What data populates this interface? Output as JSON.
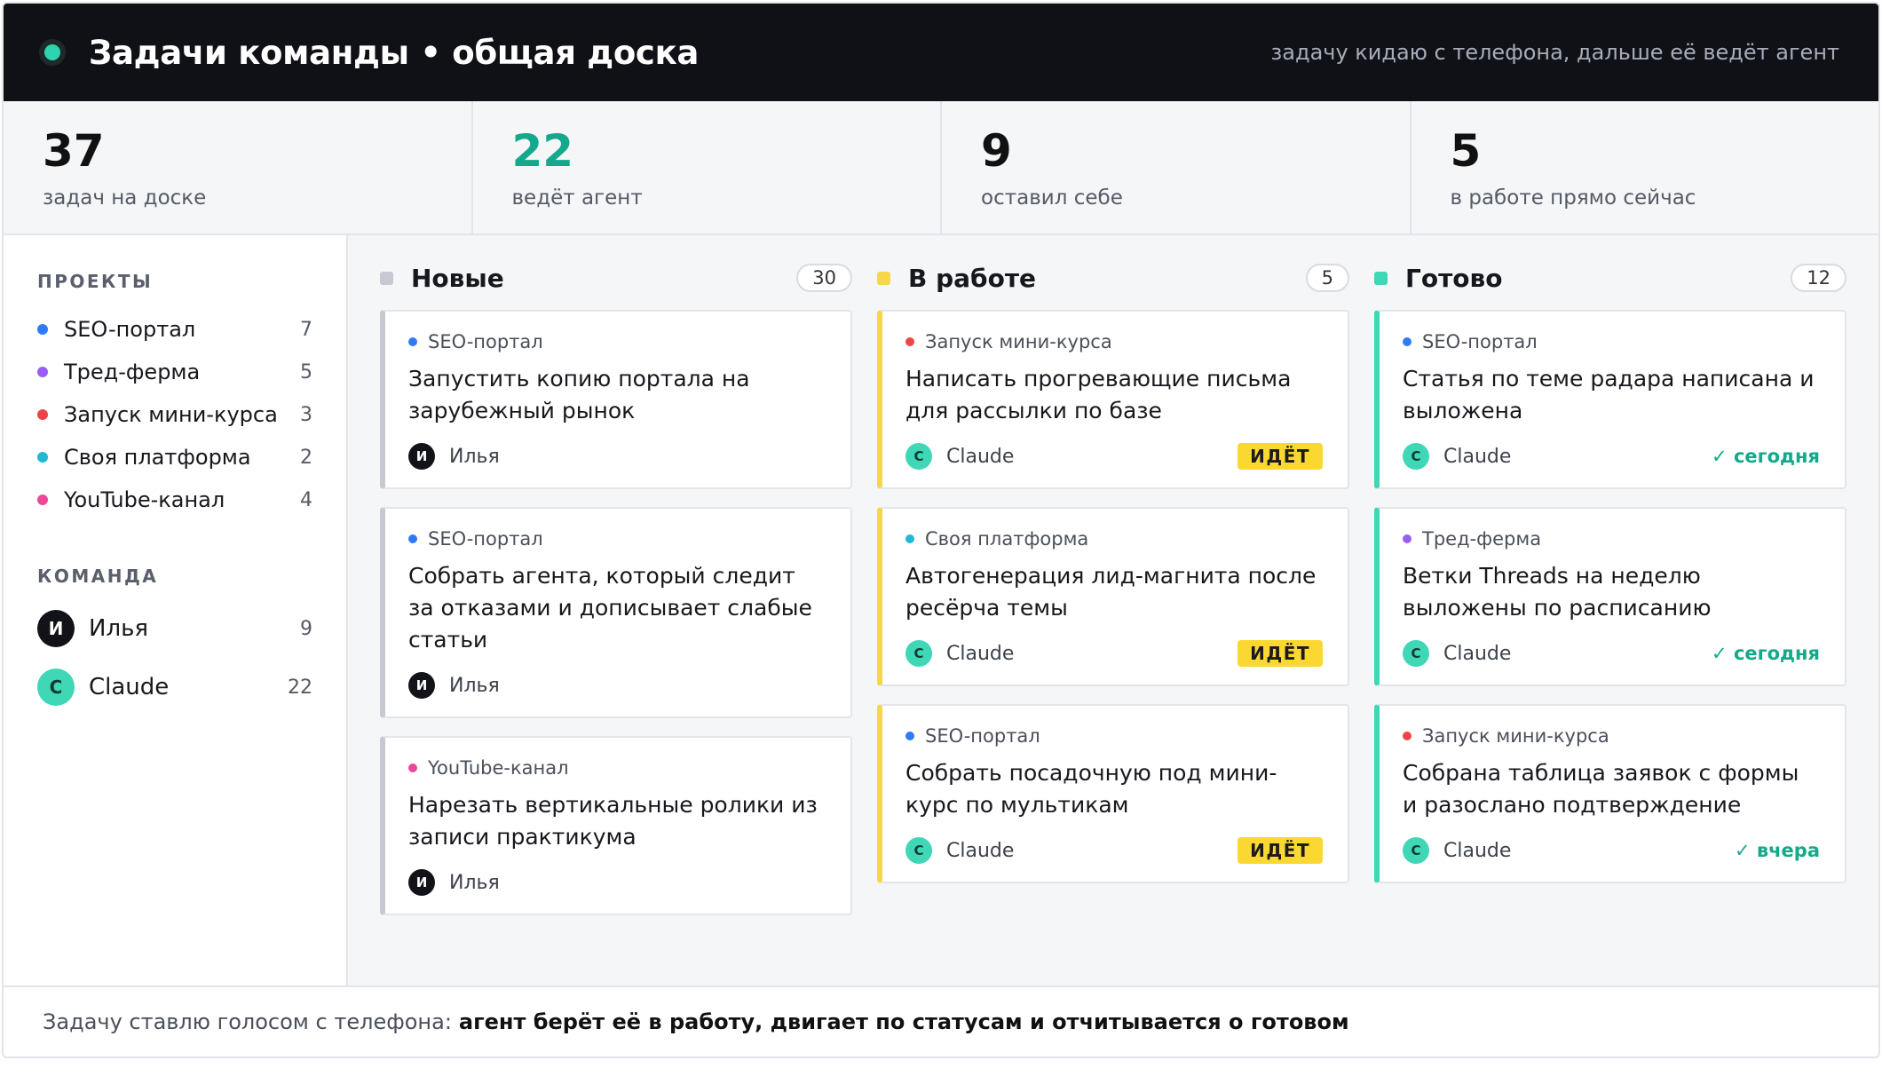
{
  "header": {
    "title": "Задачи команды • общая доска",
    "subtitle": "задачу кидаю с телефона, дальше её ведёт агент"
  },
  "stats": [
    {
      "value": "37",
      "label": "задач на доске"
    },
    {
      "value": "22",
      "label": "ведёт агент"
    },
    {
      "value": "9",
      "label": "оставил себе"
    },
    {
      "value": "5",
      "label": "в работе прямо сейчас"
    }
  ],
  "sidebar": {
    "projects_heading": "ПРОЕКТЫ",
    "projects": [
      {
        "name": "SEO-портал",
        "count": "7",
        "color": "#2f7bf5"
      },
      {
        "name": "Тред-ферма",
        "count": "5",
        "color": "#9b5cf6"
      },
      {
        "name": "Запуск мини-курса",
        "count": "3",
        "color": "#ef4444"
      },
      {
        "name": "Своя платформа",
        "count": "2",
        "color": "#22b8d6"
      },
      {
        "name": "YouTube-канал",
        "count": "4",
        "color": "#ec4899"
      }
    ],
    "team_heading": "КОМАНДА",
    "team": [
      {
        "initial": "И",
        "name": "Илья",
        "count": "9",
        "avatar": "dark"
      },
      {
        "initial": "C",
        "name": "Claude",
        "count": "22",
        "avatar": "teal"
      }
    ]
  },
  "columns": [
    {
      "title": "Новые",
      "count": "30",
      "color": "#c6c9d1",
      "variant": "gray",
      "cards": [
        {
          "project": "SEO-портал",
          "project_color": "#2f7bf5",
          "title": "Запустить копию портала на зарубежный рынок",
          "initial": "И",
          "assignee": "Илья",
          "avatar": "dark",
          "status": ""
        },
        {
          "project": "SEO-портал",
          "project_color": "#2f7bf5",
          "title": "Собрать агента, который следит за отказами и дописывает слабые статьи",
          "initial": "И",
          "assignee": "Илья",
          "avatar": "dark",
          "status": ""
        },
        {
          "project": "YouTube-канал",
          "project_color": "#ec4899",
          "title": "Нарезать вертикальные ролики из записи практикума",
          "initial": "И",
          "assignee": "Илья",
          "avatar": "dark",
          "status": ""
        }
      ]
    },
    {
      "title": "В работе",
      "count": "5",
      "color": "#f5d84a",
      "variant": "yellow",
      "cards": [
        {
          "project": "Запуск мини-курса",
          "project_color": "#ef4444",
          "title": "Написать прогревающие письма для рассылки по базе",
          "initial": "C",
          "assignee": "Claude",
          "avatar": "teal",
          "status": "ИДЁТ",
          "status_type": "run"
        },
        {
          "project": "Своя платформа",
          "project_color": "#22b8d6",
          "title": "Автогенерация лид-магнита после ресёрча темы",
          "initial": "C",
          "assignee": "Claude",
          "avatar": "teal",
          "status": "ИДЁТ",
          "status_type": "run"
        },
        {
          "project": "SEO-портал",
          "project_color": "#2f7bf5",
          "title": "Собрать посадочную под мини-курс по мультикам",
          "initial": "C",
          "assignee": "Claude",
          "avatar": "teal",
          "status": "ИДЁТ",
          "status_type": "run"
        }
      ]
    },
    {
      "title": "Готово",
      "count": "12",
      "color": "#3fd7b5",
      "variant": "teal",
      "cards": [
        {
          "project": "SEO-портал",
          "project_color": "#2f7bf5",
          "title": "Статья по теме радара написана и выложена",
          "initial": "C",
          "assignee": "Claude",
          "avatar": "teal",
          "status": "✓ сегодня",
          "status_type": "done"
        },
        {
          "project": "Тред-ферма",
          "project_color": "#9b5cf6",
          "title": "Ветки Threads на неделю выложены по расписанию",
          "initial": "C",
          "assignee": "Claude",
          "avatar": "teal",
          "status": "✓ сегодня",
          "status_type": "done"
        },
        {
          "project": "Запуск мини-курса",
          "project_color": "#ef4444",
          "title": "Собрана таблица заявок с формы и разослано подтверждение",
          "initial": "C",
          "assignee": "Claude",
          "avatar": "teal",
          "status": "✓ вчера",
          "status_type": "done"
        }
      ]
    }
  ],
  "footer": {
    "lead": "Задачу ставлю голосом с телефона:",
    "strong": "агент берёт её в работу, двигает по статусам и отчитывается о готовом"
  }
}
